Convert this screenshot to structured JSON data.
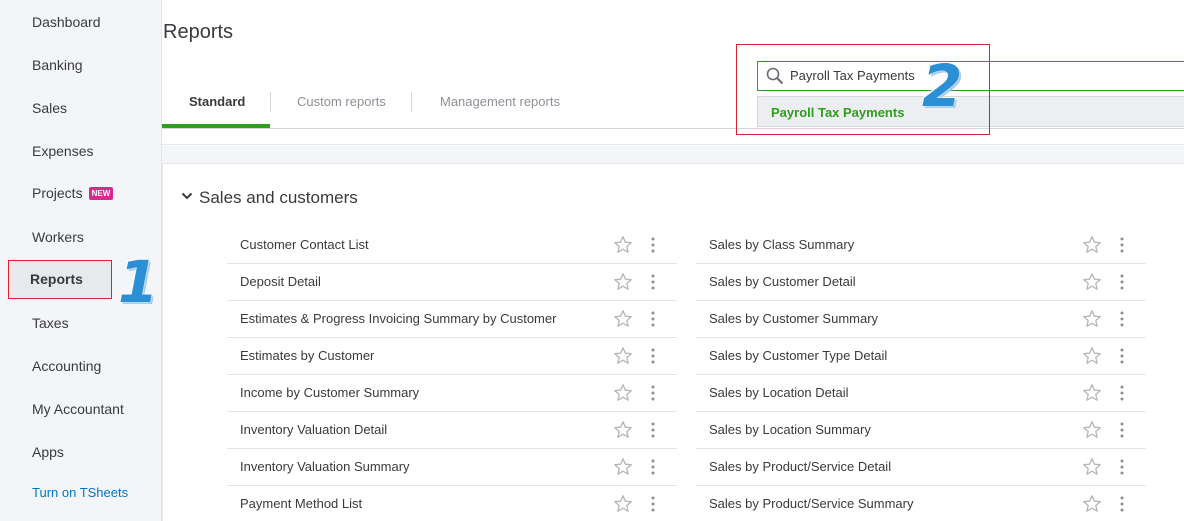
{
  "sidebar": {
    "items": [
      {
        "label": "Dashboard"
      },
      {
        "label": "Banking"
      },
      {
        "label": "Sales"
      },
      {
        "label": "Expenses"
      },
      {
        "label": "Projects",
        "badge": "NEW"
      },
      {
        "label": "Workers"
      },
      {
        "label": "Reports",
        "active": true
      },
      {
        "label": "Taxes"
      },
      {
        "label": "Accounting"
      },
      {
        "label": "My Accountant"
      },
      {
        "label": "Apps"
      },
      {
        "label": "Turn on TSheets"
      }
    ]
  },
  "annotations": {
    "step1": "1",
    "step2": "2"
  },
  "header": {
    "title": "Reports"
  },
  "tabs": [
    {
      "label": "Standard",
      "active": true
    },
    {
      "label": "Custom reports"
    },
    {
      "label": "Management reports"
    }
  ],
  "search": {
    "value": "Payroll Tax Payments",
    "suggestion": "Payroll Tax Payments"
  },
  "section": {
    "title": "Sales and customers",
    "left_reports": [
      "Customer Contact List",
      "Deposit Detail",
      "Estimates & Progress Invoicing Summary by Customer",
      "Estimates by Customer",
      "Income by Customer Summary",
      "Inventory Valuation Detail",
      "Inventory Valuation Summary",
      "Payment Method List"
    ],
    "right_reports": [
      "Sales by Class Summary",
      "Sales by Customer Detail",
      "Sales by Customer Summary",
      "Sales by Customer Type Detail",
      "Sales by Location Detail",
      "Sales by Location Summary",
      "Sales by Product/Service Detail",
      "Sales by Product/Service Summary"
    ]
  },
  "colors": {
    "accent_green": "#2ca01c",
    "link_blue": "#0077c5",
    "badge_pink": "#d52b8c",
    "annotation_red": "#d9232d"
  },
  "icons": {
    "favorite": "star-outline-icon",
    "more": "kebab-menu-icon",
    "search": "magnifier-icon",
    "collapse": "chevron-down-icon"
  }
}
